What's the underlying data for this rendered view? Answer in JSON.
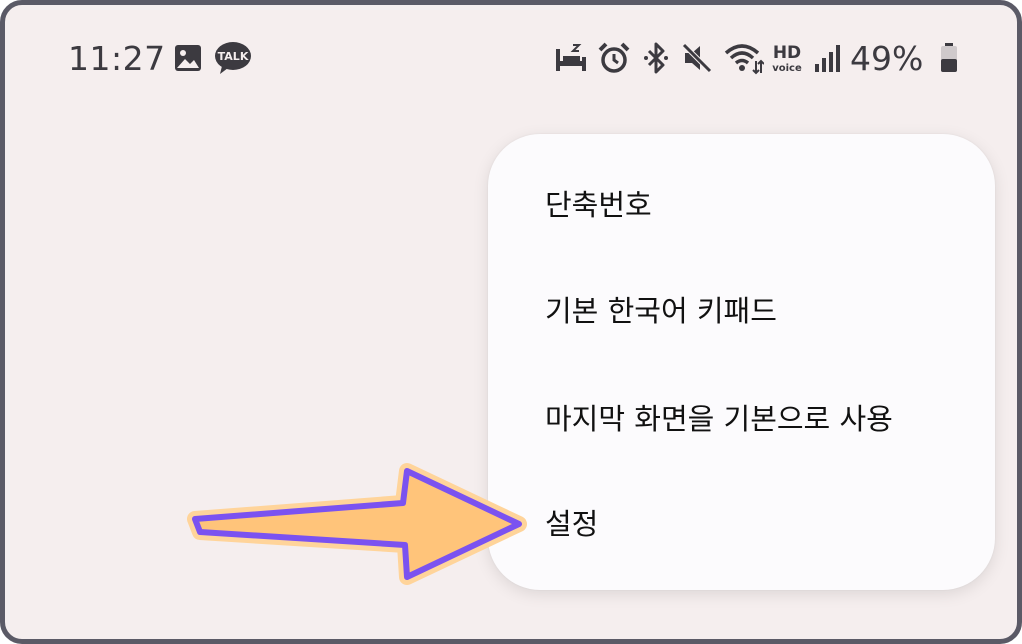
{
  "status_bar": {
    "time": "11:27",
    "notification_icons": [
      "gallery-image-icon",
      "kakaotalk-icon"
    ],
    "kakaotalk_label": "TALK",
    "system_icons": [
      "sleep-mode-icon",
      "alarm-icon",
      "bluetooth-icon",
      "mute-icon",
      "wifi-icon",
      "hd-voice-icon",
      "signal-icon",
      "battery-icon"
    ],
    "hd_label": "HD",
    "voice_label": "voice",
    "battery_percent": "49%",
    "battery_level": 0.49
  },
  "menu": {
    "items": [
      {
        "label": "단축번호"
      },
      {
        "label": "기본 한국어 키패드"
      },
      {
        "label": "마지막 화면을 기본으로 사용"
      },
      {
        "label": "설정"
      }
    ]
  },
  "annotation": {
    "arrow_target": "설정",
    "arrow_fill": "#ffc47a",
    "arrow_outline": "#7b52f0"
  },
  "colors": {
    "background": "#f5eeee",
    "menu_background": "#fcfbfd",
    "frame_border": "#5b5a66",
    "text": "#111111",
    "status_text": "#3c3a40"
  }
}
